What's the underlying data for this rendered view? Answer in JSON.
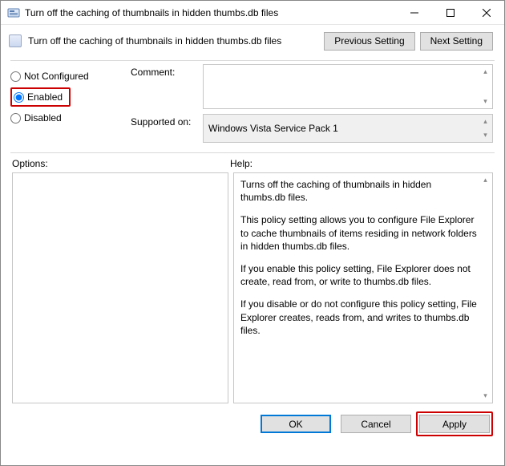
{
  "window": {
    "title": "Turn off the caching of thumbnails in hidden thumbs.db files"
  },
  "subtitle": "Turn off the caching of thumbnails in hidden thumbs.db files",
  "nav": {
    "previous": "Previous Setting",
    "next": "Next Setting"
  },
  "radios": {
    "not_configured": "Not Configured",
    "enabled": "Enabled",
    "disabled": "Disabled",
    "selected": "enabled"
  },
  "labels": {
    "comment": "Comment:",
    "supported": "Supported on:",
    "options": "Options:",
    "help": "Help:"
  },
  "comment_value": "",
  "supported_value": "Windows Vista Service Pack 1",
  "options_value": "",
  "help_paragraphs": {
    "p0": "Turns off the caching of thumbnails in hidden thumbs.db files.",
    "p1": "This policy setting allows you to configure File Explorer to cache thumbnails of items residing in network folders in hidden thumbs.db files.",
    "p2": "If you enable this policy setting, File Explorer does not create, read from, or write to thumbs.db files.",
    "p3": "If you disable or do not configure this policy setting, File Explorer creates, reads from, and writes to thumbs.db files."
  },
  "footer": {
    "ok": "OK",
    "cancel": "Cancel",
    "apply": "Apply"
  }
}
